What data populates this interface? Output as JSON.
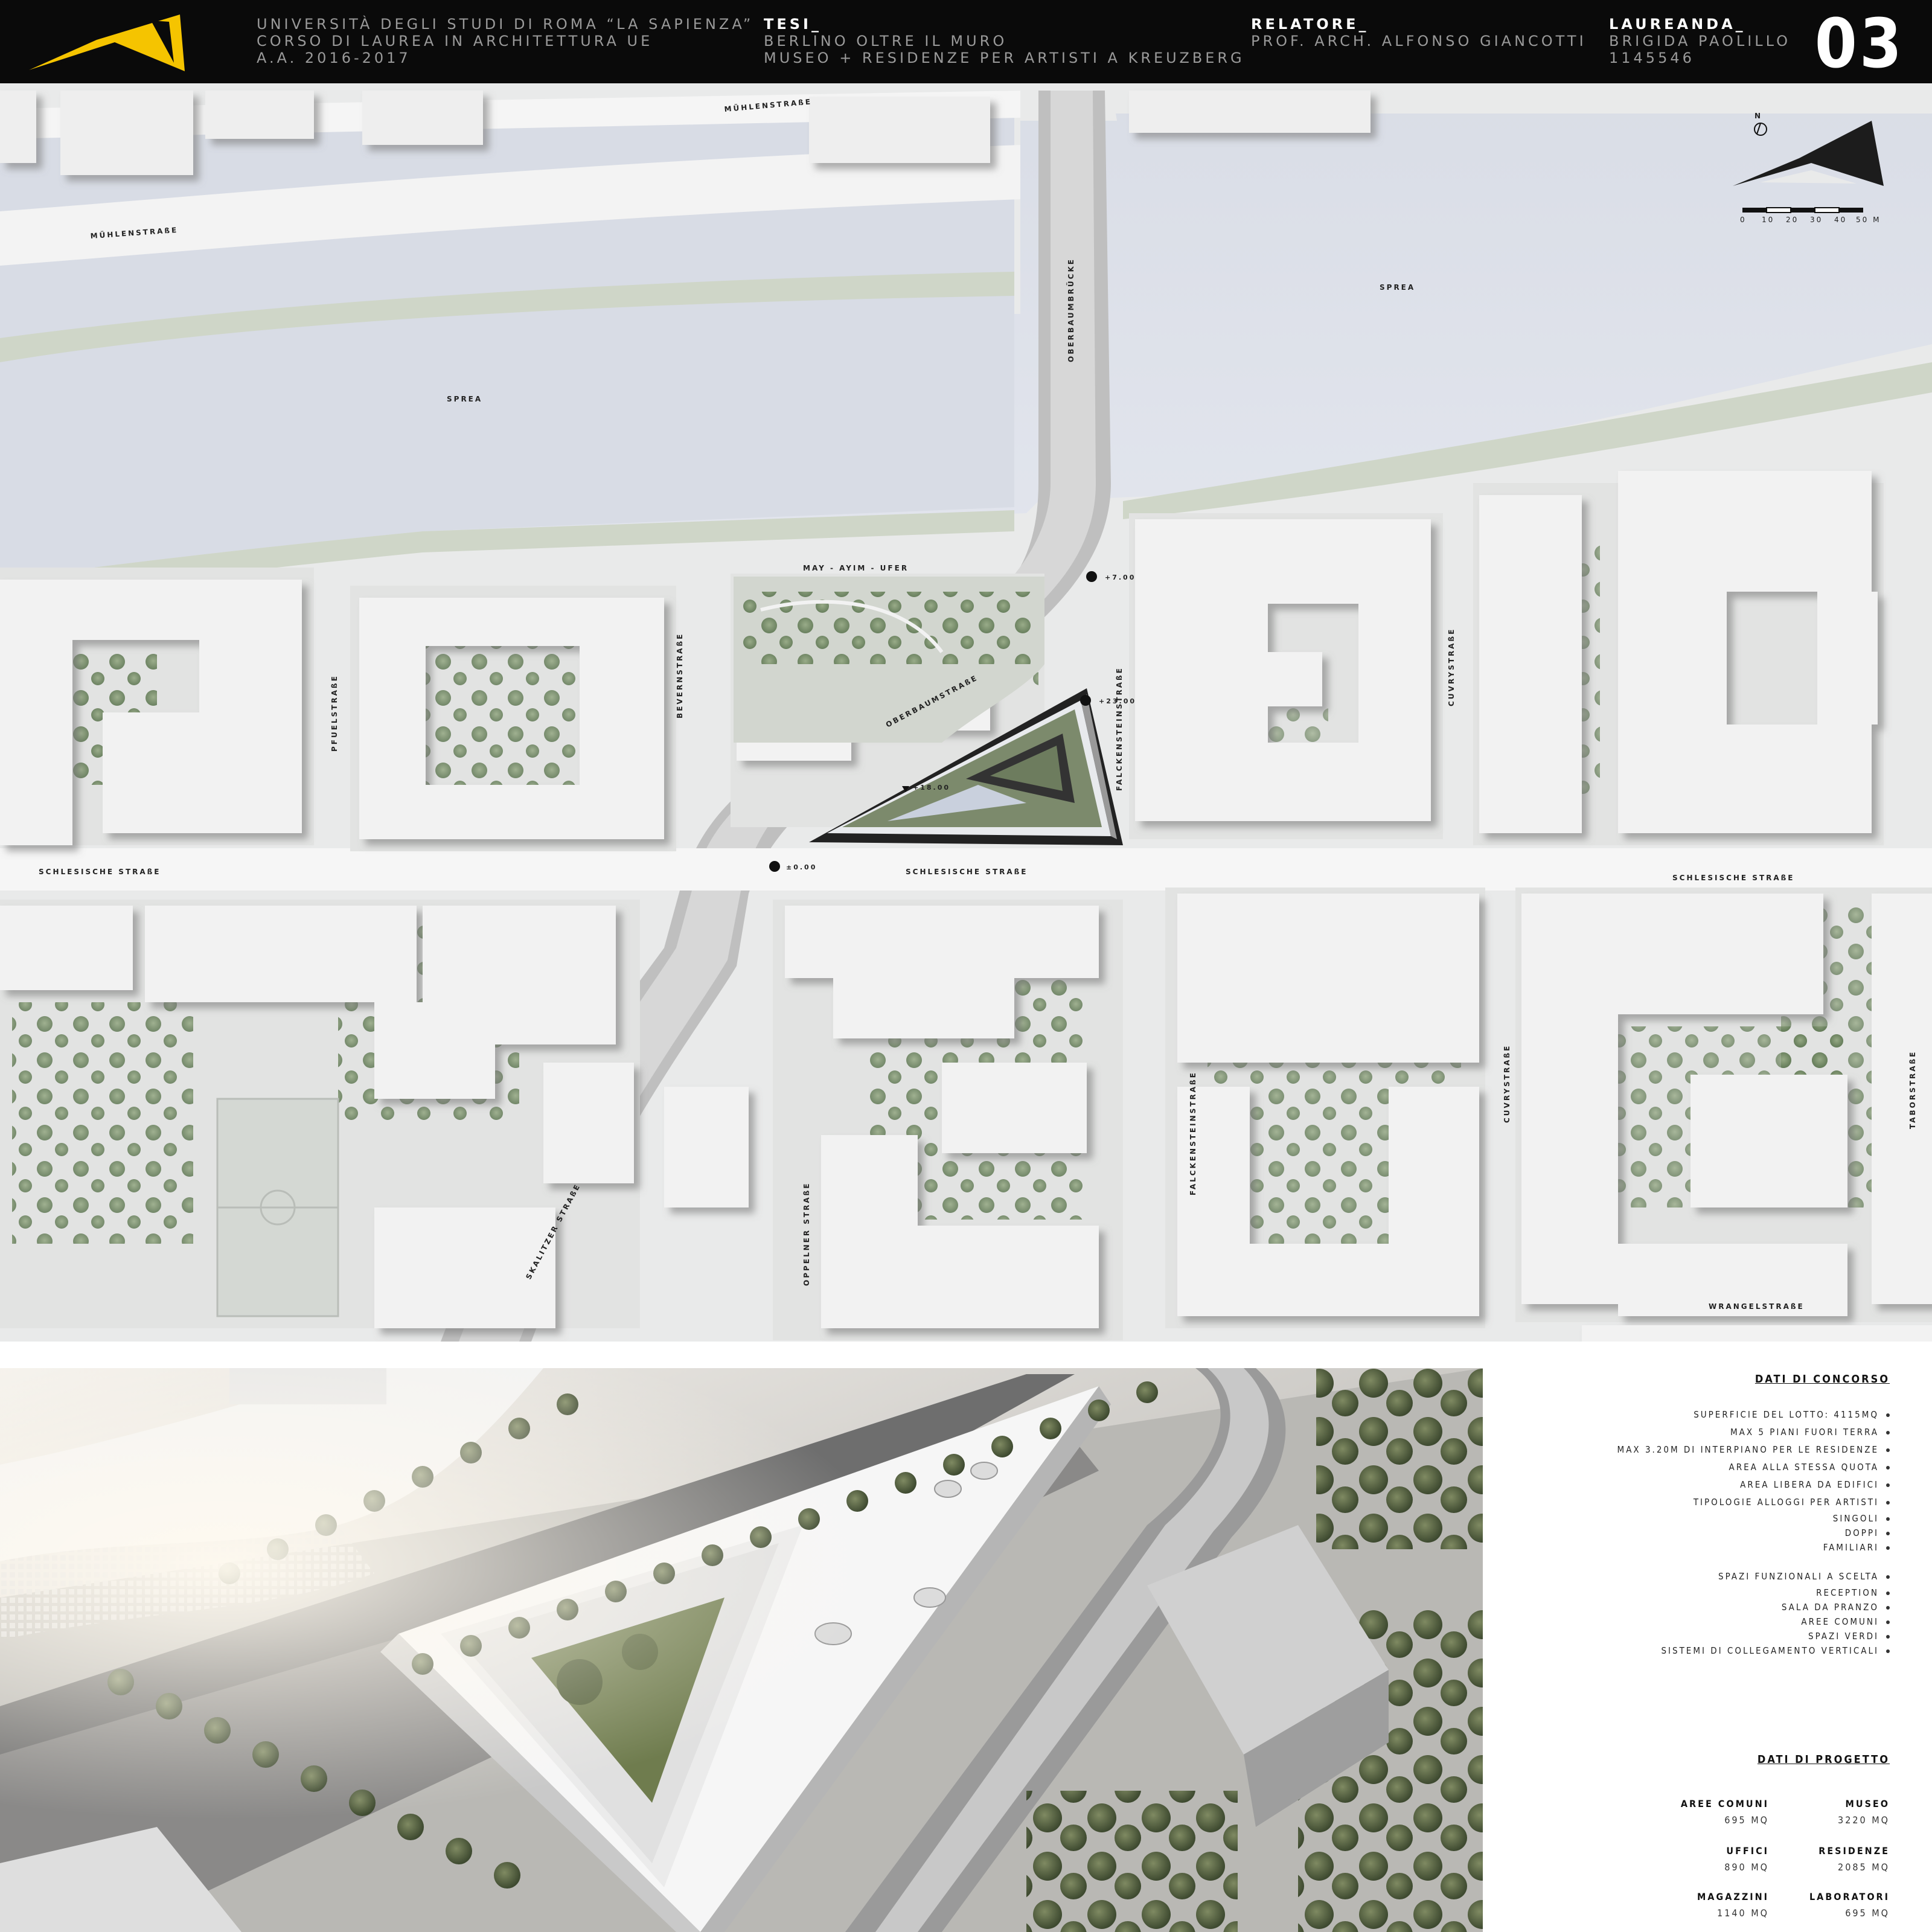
{
  "header": {
    "university": [
      "UNIVERSITÀ DEGLI STUDI DI ROMA “LA SAPIENZA”",
      "CORSO DI LAUREA IN ARCHITETTURA UE",
      "A.A. 2016-2017"
    ],
    "tesi_label": "TESI_",
    "tesi_lines": [
      "BERLINO OLTRE IL MURO",
      "MUSEO + RESIDENZE PER ARTISTI A KREUZBERG"
    ],
    "relatore_label": "RELATORE_",
    "relatore_name": "PROF. ARCH. ALFONSO GIANCOTTI",
    "laureanda_label": "LAUREANDA_",
    "laureanda_name": "BRIGIDA PAOLILLO",
    "matricola": "1145546",
    "sheet_number": "03",
    "logo_color": "#f5c400"
  },
  "map": {
    "north_label": "N",
    "scale_ticks": [
      "0",
      "10",
      "20",
      "30",
      "40",
      "50 M"
    ],
    "labels": {
      "muehlenstrasse_1": "MÜHLENSTRAßE",
      "muehlenstrasse_2": "MÜHLENSTRAßE",
      "sprea_left": "SPREA",
      "sprea_right": "SPREA",
      "oberbaumbruecke": "OBERBAUMBRÜCKE",
      "may_ayim_ufer": "MAY - AYIM - UFER",
      "oberbaumstrasse": "OBERBAUMSTRAßE",
      "pfuelstrasse": "PFUELSTRAßE",
      "bevernstrasse": "BEVERNSTRAßE",
      "falckensteinstrasse_top": "FALCKENSTEINSTRAßE",
      "cuvrystrasse_top": "CUVRYSTRAßE",
      "schlesische_left": "SCHLESISCHE STRAßE",
      "schlesische_mid": "SCHLESISCHE STRAßE",
      "schlesische_right": "SCHLESISCHE STRAßE",
      "skalitzer": "SKALITZER STRAßE",
      "oppelner": "OPPELNER STRAßE",
      "falckensteinstrasse_bottom": "FALCKENSTEINSTRAßE",
      "cuvrystrasse_bottom": "CUVRYSTRAßE",
      "taborstrasse": "TABORSTRAßE",
      "wrangelstrasse": "WRANGELSTRAßE",
      "level_700": "+7.00",
      "level_2300": "+23.00",
      "level_1800": "+18.00",
      "level_000": "±0.00"
    }
  },
  "dati_concorso": {
    "title": "DATI DI CONCORSO",
    "items": [
      "SUPERFICIE DEL LOTTO: 4115MQ",
      "MAX 5 PIANI FUORI TERRA",
      "MAX 3.20M DI INTERPIANO PER LE RESIDENZE",
      "AREA ALLA STESSA QUOTA",
      "AREA LIBERA DA EDIFICI",
      "TIPOLOGIE ALLOGGI PER ARTISTI"
    ],
    "alloggi_sub": [
      "SINGOLI",
      "DOPPI",
      "FAMILIARI"
    ],
    "spazi_title": "SPAZI FUNZIONALI A SCELTA",
    "spazi_sub": [
      "RECEPTION",
      "SALA DA PRANZO",
      "AREE COMUNI",
      "SPAZI VERDI",
      "SISTEMI DI COLLEGAMENTO VERTICALI"
    ]
  },
  "dati_progetto": {
    "title": "DATI DI PROGETTO",
    "stats": [
      {
        "label": "AREE COMUNI",
        "value": "695 MQ"
      },
      {
        "label": "MUSEO",
        "value": "3220 MQ"
      },
      {
        "label": "UFFICI",
        "value": "890 MQ"
      },
      {
        "label": "RESIDENZE",
        "value": "2085 MQ"
      },
      {
        "label": "MAGAZZINI",
        "value": "1140 MQ"
      },
      {
        "label": "LABORATORI",
        "value": "695 MQ"
      }
    ]
  }
}
